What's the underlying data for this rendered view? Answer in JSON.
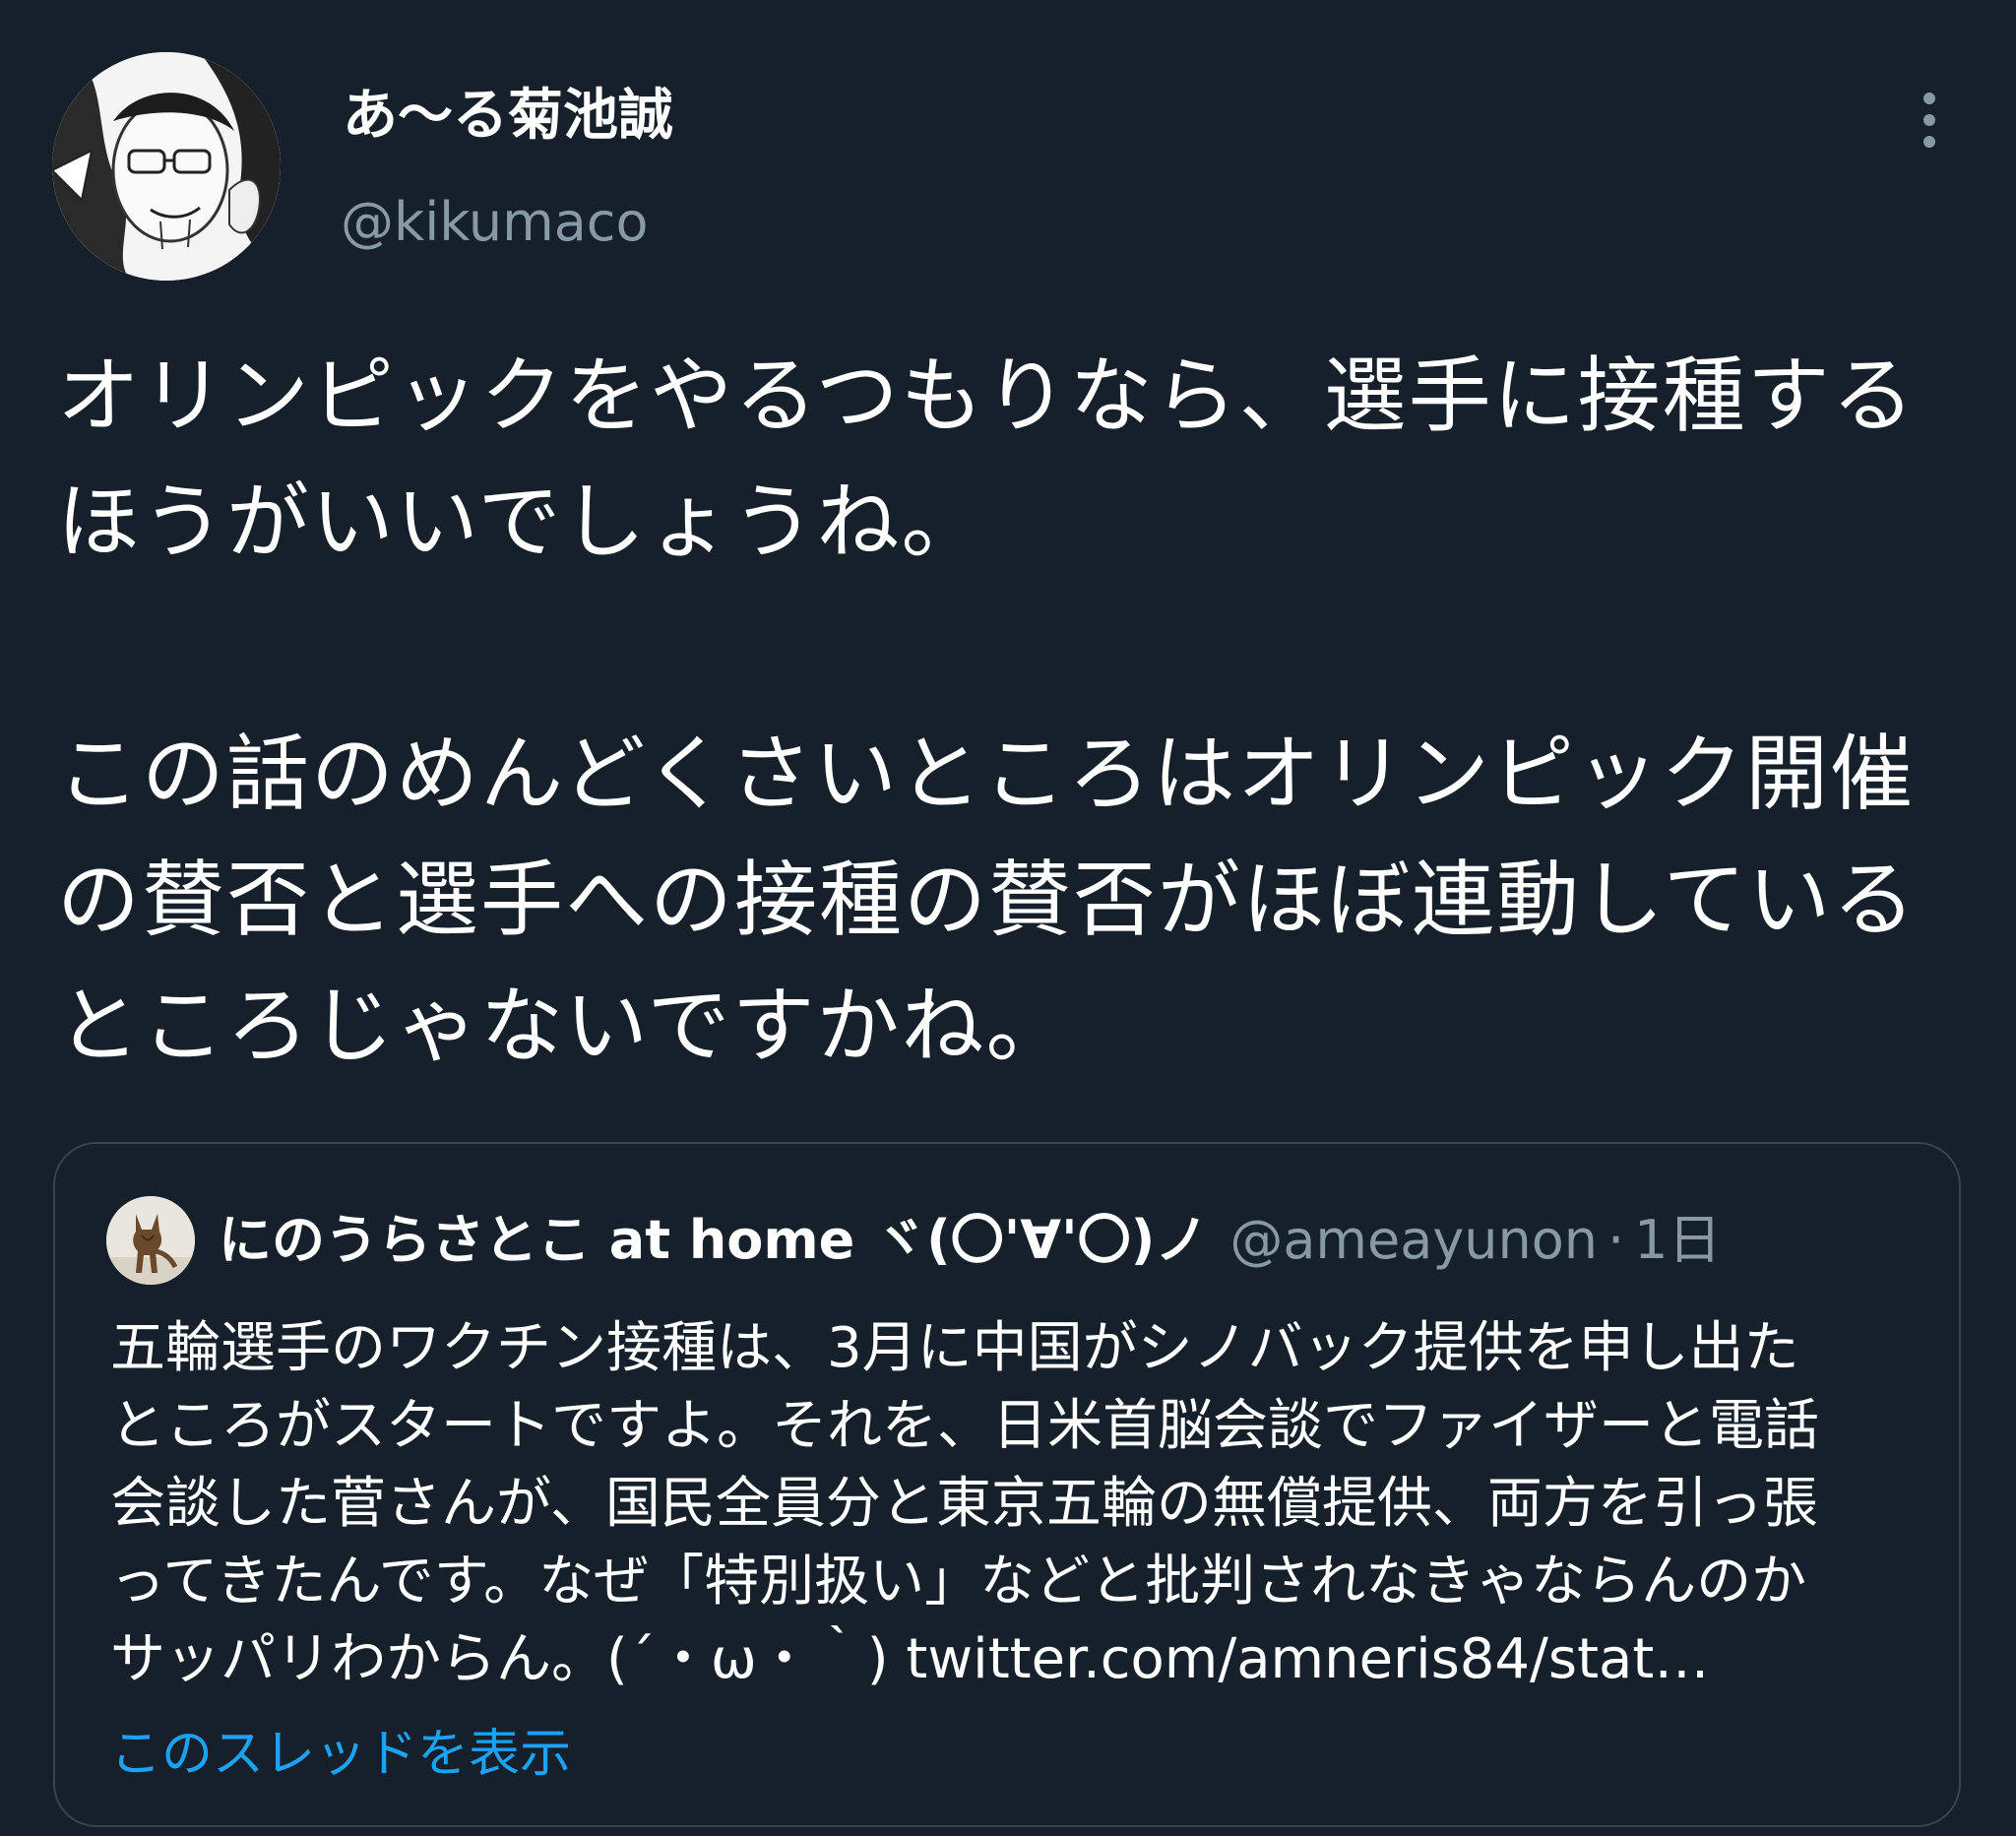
{
  "author": {
    "display_name": "あ〜る菊池誠",
    "handle": "@kikumaco"
  },
  "tweet": {
    "paragraph_1": "オリンピックをやるつもりなら、選手に接種する\nほうがいいでしょうね。",
    "paragraph_2": "この話のめんどくさいところはオリンピック開催\nの賛否と選手への接種の賛否がほぼ連動している\nところじゃないですかね。"
  },
  "quote": {
    "display_name": "にのうらさとこ at home ヾ(〇'∀'〇)ノ",
    "handle": "@ameayunon",
    "separator": "·",
    "time": "1日",
    "text": "五輪選手のワクチン接種は、3月に中国がシノバック提供を申し出た\nところがスタートですよ。それを、日米首脳会談でファイザーと電話\n会談した菅さんが、国民全員分と東京五輪の無償提供、両方を引っ張\nってきたんです。なぜ「特別扱い」などと批判されなきゃならんのか\nサッパリわからん。(´・ω・｀) twitter.com/amneris84/stat…",
    "show_thread_label": "このスレッドを表示"
  },
  "icons": {
    "more": "more-vertical-icon"
  },
  "colors": {
    "background": "#15202b",
    "text_primary": "#ffffff",
    "text_secondary": "#8899a6",
    "border": "#38444d",
    "link": "#1da1f2"
  }
}
